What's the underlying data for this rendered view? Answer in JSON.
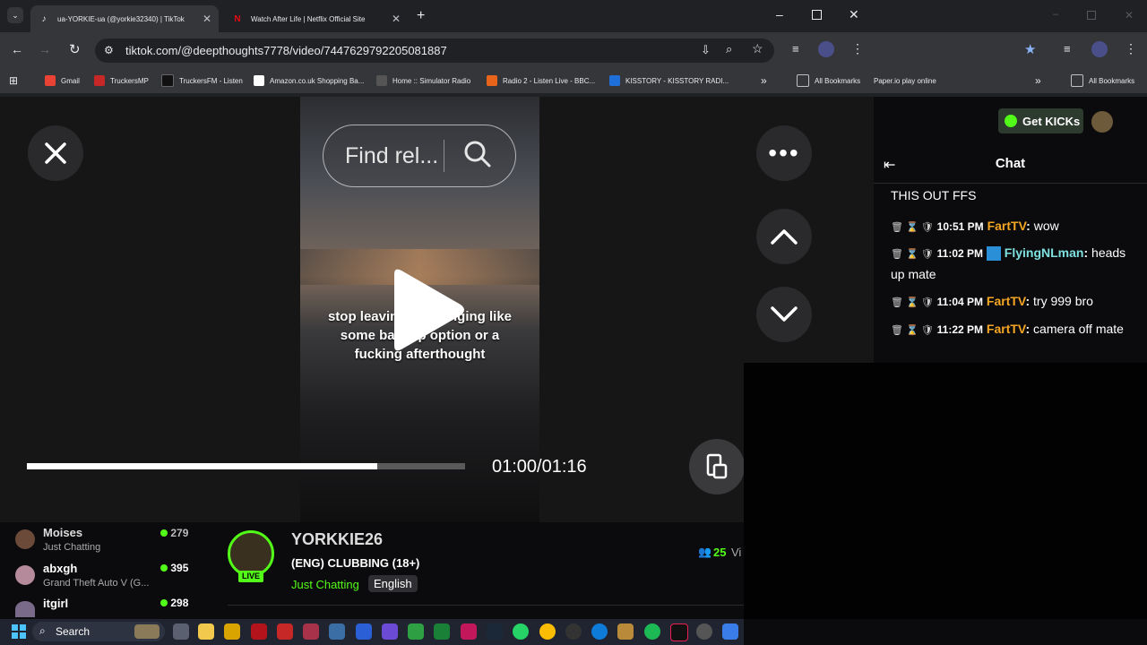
{
  "browser": {
    "tabs": [
      {
        "title": "ua-YORKIE-ua (@yorkie32340) | TikTok",
        "active": true
      },
      {
        "title": "Watch After Life | Netflix Official Site",
        "active": false
      }
    ],
    "url": "tiktok.com/@deepthoughts7778/video/7447629792205081887",
    "bookmarks": [
      "Gmail",
      "TruckersMP",
      "TruckersFM - Listen",
      "Amazon.co.uk Shopping Ba...",
      "Home :: Simulator Radio",
      "Radio 2 - Listen Live - BBC...",
      "KISSTORY - KISSTORY RADI..."
    ],
    "all_bookmarks_label": "All Bookmarks",
    "second_window": {
      "bookmark": "Paper.io play online",
      "all_bookmarks_label": "All Bookmarks"
    }
  },
  "tiktok": {
    "search_placeholder": "Find rel...",
    "caption_lines": [
      "stop leaving me hanging like",
      "some backup option or a",
      "fucking afterthought"
    ],
    "time": "01:00/01:16",
    "progress": 0.8
  },
  "kick": {
    "get_kicks_label": "Get KICKs",
    "chat_title": "Chat",
    "chat_messages": [
      {
        "time": "",
        "user": "",
        "text": "THIS OUT FFS",
        "user_color": "#ffffff"
      },
      {
        "time": "10:51 PM",
        "user": "FartTV",
        "text": "wow",
        "user_color": "#f5a623"
      },
      {
        "time": "11:02 PM",
        "user": "FlyingNLman",
        "text": "heads up mate",
        "user_color": "#7fe0e0"
      },
      {
        "time": "11:04 PM",
        "user": "FartTV",
        "text": "try 999 bro",
        "user_color": "#f5a623"
      },
      {
        "time": "11:22 PM",
        "user": "FartTV",
        "text": "camera off mate",
        "user_color": "#f5a623"
      }
    ],
    "channels": [
      {
        "name": "Moises",
        "category": "Just Chatting",
        "viewers": "279"
      },
      {
        "name": "abxgh",
        "category": "Grand Theft Auto V (G...",
        "viewers": "395"
      },
      {
        "name": "itgirl",
        "category": "",
        "viewers": "298"
      }
    ],
    "streamer": {
      "name": "YORKKIE26",
      "title": "(ENG) CLUBBING (18+)",
      "category": "Just Chatting",
      "language": "English",
      "live_label": "LIVE",
      "viewers": "25",
      "viewers_suffix": "Vi"
    }
  },
  "taskbar": {
    "search_label": "Search"
  }
}
